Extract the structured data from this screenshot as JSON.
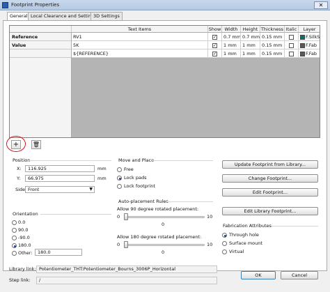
{
  "window": {
    "title": "Footprint Properties",
    "close_glyph": "✕"
  },
  "tabs": [
    {
      "label": "General"
    },
    {
      "label": "Local Clearance and Settings"
    },
    {
      "label": "3D Settings"
    }
  ],
  "grid": {
    "columns": [
      "Text Items",
      "Show",
      "Width",
      "Height",
      "Thickness",
      "Italic",
      "Layer"
    ],
    "rows": [
      {
        "label": "Reference",
        "text": "RV1",
        "show": "✓",
        "width": "0.7 mm",
        "height": "0.7 mm",
        "thickness": "0.15 mm",
        "italic": "",
        "layer": "F.SilkS",
        "layer_color": "#0e6f6b"
      },
      {
        "label": "Value",
        "text": "5K",
        "show": "✓",
        "width": "1 mm",
        "height": "1 mm",
        "thickness": "0.15 mm",
        "italic": "",
        "layer": "F.Fab",
        "layer_color": "#5a5a5a"
      },
      {
        "label": "",
        "text": "${REFERENCE}",
        "show": "✓",
        "width": "1 mm",
        "height": "1 mm",
        "thickness": "0.15 mm",
        "italic": "",
        "layer": "F.Fab",
        "layer_color": "#5a5a5a"
      }
    ],
    "add_glyph": "+",
    "delete_glyph": "🗑"
  },
  "position": {
    "title": "Position",
    "x_label": "X:",
    "x_value": "116.925",
    "x_unit": "mm",
    "y_label": "Y:",
    "y_value": "66.975",
    "y_unit": "mm",
    "side_label": "Side:",
    "side_value": "Front"
  },
  "orientation": {
    "title": "Orientation",
    "options": [
      "0.0",
      "90.0",
      "-90.0",
      "180.0"
    ],
    "other_label": "Other:",
    "other_value": "180.0",
    "selected": "180.0"
  },
  "move_place": {
    "title": "Move and Place",
    "options": [
      "Free",
      "Lock pads",
      "Lock footprint"
    ],
    "selected": "Lock pads"
  },
  "auto_place": {
    "title": "Auto-placement Rules",
    "slider90_label": "Allow 90 degree rotated placement:",
    "slider90_min": "0",
    "slider90_max": "10",
    "slider90_value": "0",
    "slider180_label": "Allow 180 degree rotated placement:",
    "slider180_min": "0",
    "slider180_max": "10",
    "slider180_value": "0"
  },
  "buttons": {
    "update": "Update Footprint from Library...",
    "change": "Change Footprint...",
    "edit": "Edit Footprint...",
    "edit_lib": "Edit Library Footprint...",
    "ok": "OK",
    "cancel": "Cancel"
  },
  "fabrication": {
    "title": "Fabrication Attributes",
    "options": [
      "Through hole",
      "Surface mount",
      "Virtual"
    ],
    "selected": "Through hole"
  },
  "links": {
    "library_label": "Library link:",
    "library_value": "Potentiometer_THT:Potentiometer_Bourns_3006P_Horizontal",
    "step_label": "Step link:",
    "step_value": "/"
  }
}
